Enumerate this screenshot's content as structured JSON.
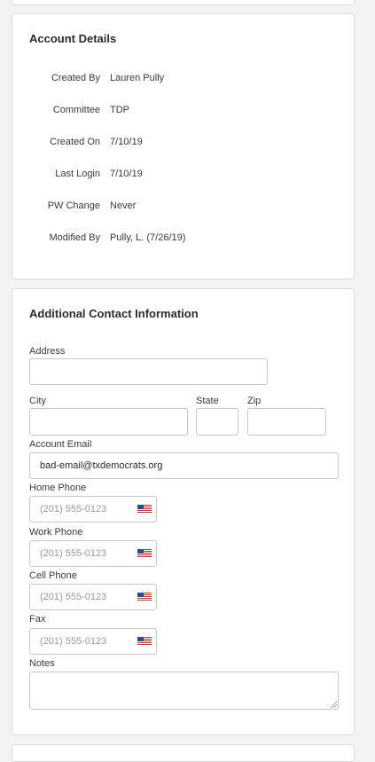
{
  "account_details": {
    "title": "Account Details",
    "rows": [
      {
        "label": "Created By",
        "value": "Lauren Pully"
      },
      {
        "label": "Committee",
        "value": "TDP"
      },
      {
        "label": "Created On",
        "value": "7/10/19"
      },
      {
        "label": "Last Login",
        "value": "7/10/19"
      },
      {
        "label": "PW Change",
        "value": "Never"
      },
      {
        "label": "Modified By",
        "value": "Pully, L. (7/26/19)"
      }
    ]
  },
  "contact": {
    "title": "Additional Contact Information",
    "address": {
      "label": "Address",
      "value": ""
    },
    "city": {
      "label": "City",
      "value": ""
    },
    "state": {
      "label": "State",
      "value": ""
    },
    "zip": {
      "label": "Zip",
      "value": ""
    },
    "account_email": {
      "label": "Account Email",
      "value": "bad-email@txdemocrats.org"
    },
    "home_phone": {
      "label": "Home Phone",
      "placeholder": "(201) 555-0123",
      "flag_icon": "us-flag-icon"
    },
    "work_phone": {
      "label": "Work Phone",
      "placeholder": "(201) 555-0123",
      "flag_icon": "us-flag-icon"
    },
    "cell_phone": {
      "label": "Cell Phone",
      "placeholder": "(201) 555-0123",
      "flag_icon": "us-flag-icon"
    },
    "fax": {
      "label": "Fax",
      "placeholder": "(201) 555-0123",
      "flag_icon": "us-flag-icon"
    },
    "notes": {
      "label": "Notes",
      "value": ""
    }
  }
}
